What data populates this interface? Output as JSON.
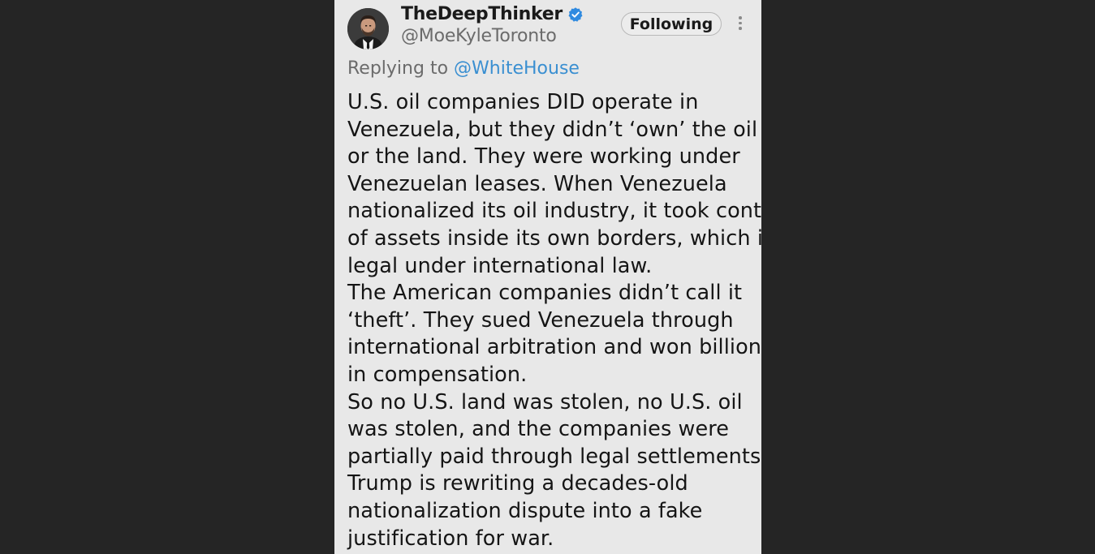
{
  "author": {
    "display_name": "TheDeepThinker",
    "handle": "@MoeKyleToronto",
    "verified_icon": "verified-badge-icon",
    "avatar_icon": "profile-photo"
  },
  "actions": {
    "follow_label": "Following",
    "more_icon": "more-vertical-icon"
  },
  "reply": {
    "prefix": "Replying to",
    "target": "@WhiteHouse"
  },
  "tweet": {
    "lines": [
      "U.S. oil companies DID operate in",
      "Venezuela, but they didn’t ‘own’ the oil",
      "or the land. They were working under",
      "Venezuelan leases. When Venezuela",
      "nationalized its oil industry, it took control",
      "of assets inside its own borders, which is",
      "legal under international law.",
      "The American companies didn’t call it",
      "‘theft’. They sued Venezuela through",
      "international arbitration and won billions",
      "in compensation.",
      "So no U.S. land was stolen, no U.S. oil",
      "was stolen, and the companies were",
      "partially paid through legal settlements.",
      "Trump is rewriting a decades-old",
      "nationalization dispute into a fake",
      "justification for war."
    ]
  },
  "colors": {
    "page_background": "#252525",
    "card_background": "#e8e8e8",
    "link": "#3a8fd1",
    "verified": "#2f8ae0"
  }
}
